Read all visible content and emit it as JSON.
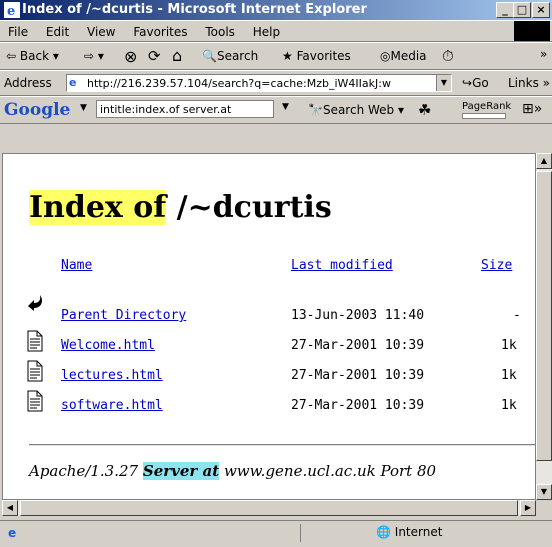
{
  "window": {
    "title": "Index of /~dcurtis - Microsoft Internet Explorer",
    "min": "_",
    "max": "□",
    "close": "×"
  },
  "menu": [
    "File",
    "Edit",
    "View",
    "Favorites",
    "Tools",
    "Help"
  ],
  "toolbar": {
    "back": "Back",
    "search": "Search",
    "favorites": "Favorites",
    "media": "Media",
    "more": "»"
  },
  "address": {
    "label": "Address",
    "url": "http://216.239.57.104/search?q=cache:Mzb_iW4IIakJ:w",
    "go": "Go",
    "links": "Links"
  },
  "google": {
    "logo": "Google",
    "query": "intitle:index.of server.at",
    "search_web": "Search Web",
    "pagerank": "PageRank"
  },
  "page": {
    "heading_hl": "Index of",
    "heading_rest": "/~dcurtis",
    "columns": {
      "name": "Name",
      "modified": "Last modified",
      "size": "Size"
    },
    "rows": [
      {
        "name": "Parent Directory",
        "modified": "13-Jun-2003 11:40",
        "size": "-",
        "icon": "back-arrow-icon"
      },
      {
        "name": "Welcome.html",
        "modified": "27-Mar-2001 10:39",
        "size": "1k",
        "icon": "document-icon"
      },
      {
        "name": "lectures.html",
        "modified": "27-Mar-2001 10:39",
        "size": "1k",
        "icon": "document-icon"
      },
      {
        "name": "software.html",
        "modified": "27-Mar-2001 10:39",
        "size": "1k",
        "icon": "document-icon"
      }
    ],
    "footer": {
      "pre": "Apache/1.3.27 ",
      "hl": "Server at",
      "post": " www.gene.ucl.ac.uk Port 80"
    }
  },
  "status": {
    "zone": "Internet"
  },
  "colors": {
    "highlight1": "#ffff66",
    "highlight2": "#8ce4ee",
    "link": "#0000cc"
  }
}
